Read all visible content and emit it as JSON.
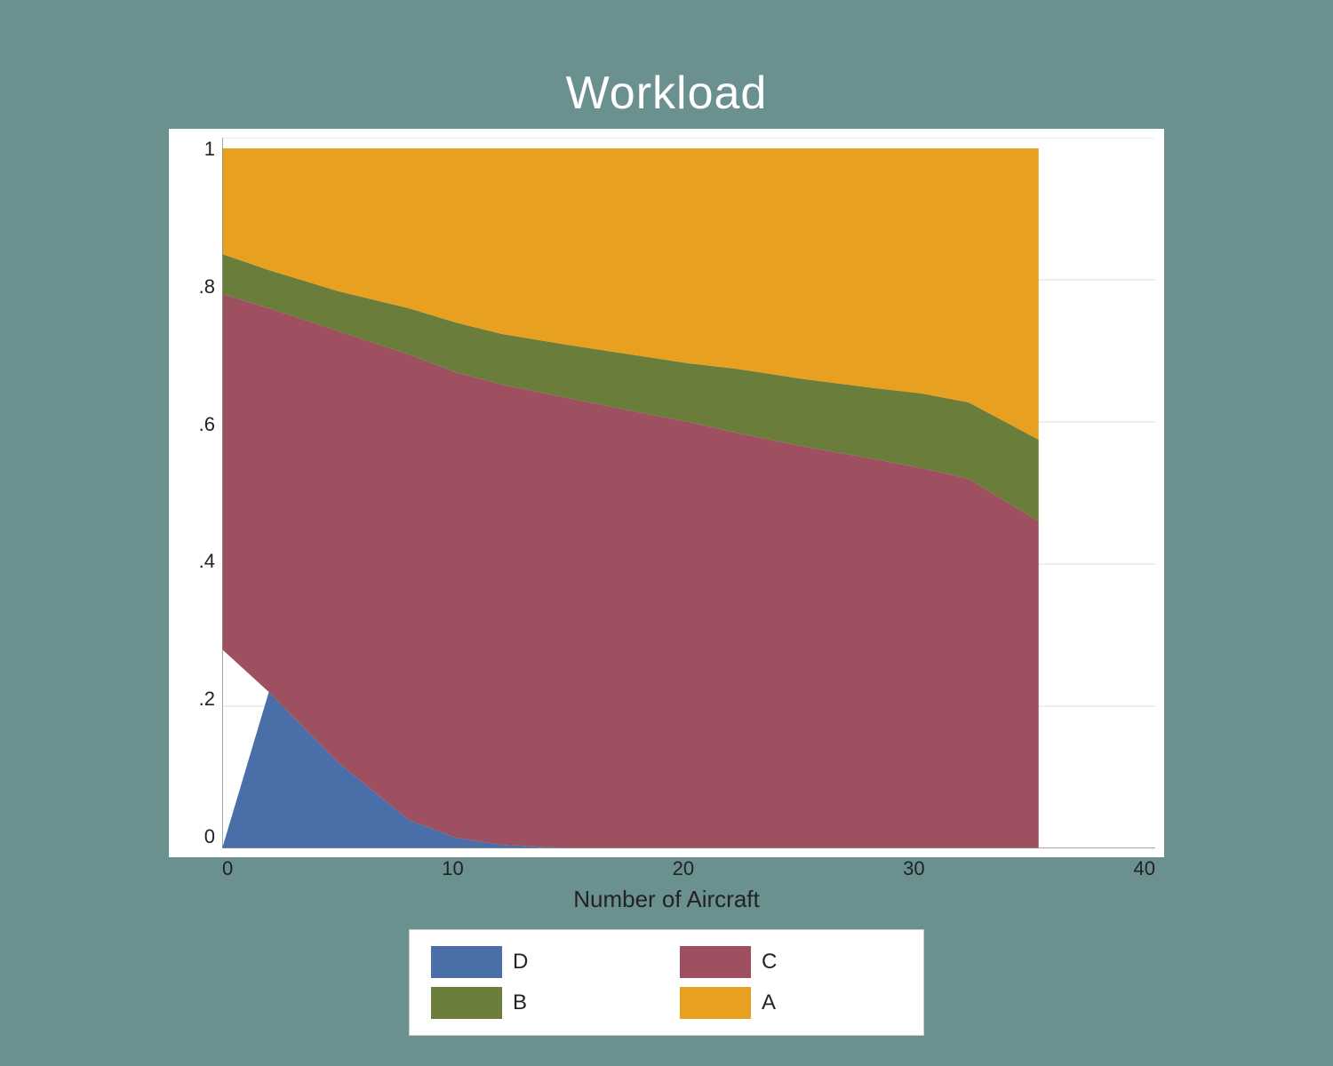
{
  "chart": {
    "title": "Workload",
    "x_axis_label": "Number of Aircraft",
    "x_ticks": [
      "0",
      "10",
      "20",
      "30",
      "40"
    ],
    "y_ticks": [
      "0",
      ".2",
      ".4",
      ".6",
      ".8",
      "1"
    ],
    "colors": {
      "A": "#E8A020",
      "B": "#6B7D3A",
      "C": "#9E5060",
      "D": "#4A6EA8"
    },
    "legend": [
      {
        "key": "D",
        "color": "#4A6EA8",
        "label": "D"
      },
      {
        "key": "C",
        "color": "#9E5060",
        "label": "C"
      },
      {
        "key": "B",
        "color": "#6B7D3A",
        "label": "B"
      },
      {
        "key": "A",
        "color": "#E8A020",
        "label": "A"
      }
    ]
  }
}
